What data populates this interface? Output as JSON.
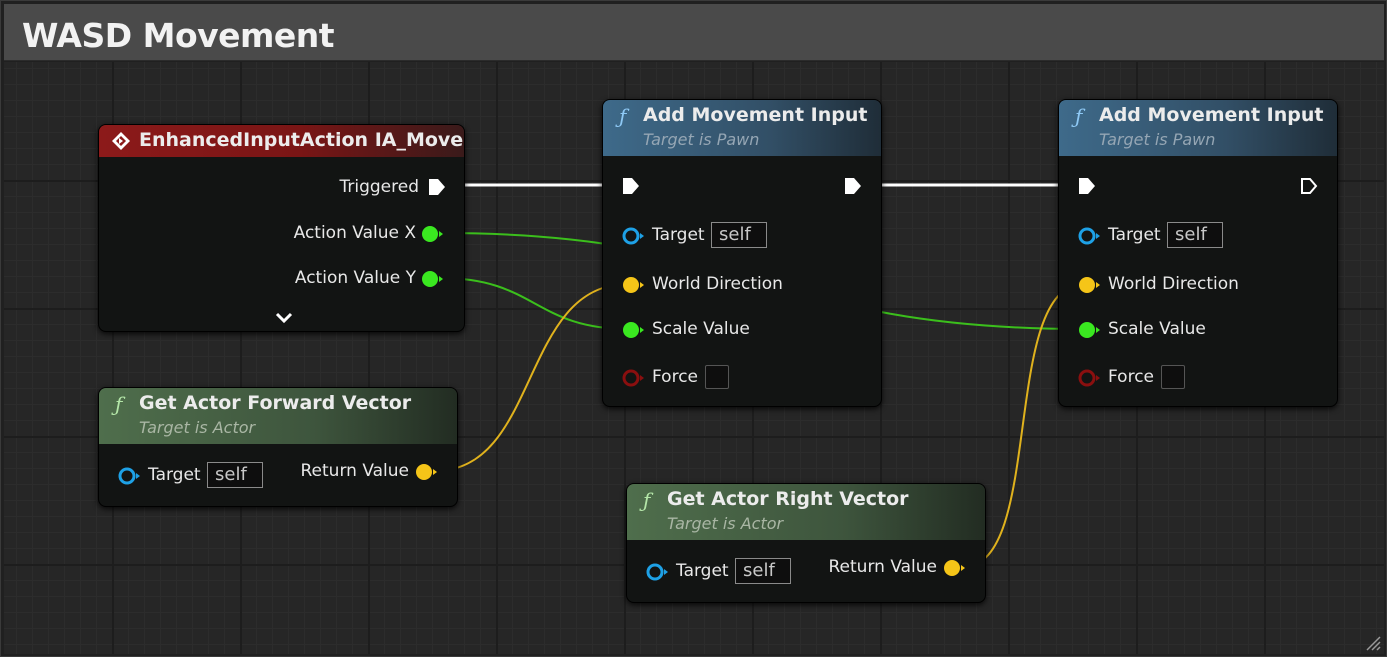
{
  "graph": {
    "comment_title": "WASD Movement"
  },
  "colors": {
    "exec": "#ffffff",
    "float_pin": "#3ae820",
    "vector_pin": "#f5c518",
    "object_pin": "#1ea1e6",
    "bool_pin": "#8a0f0f",
    "float_wire": "#3bbf1c",
    "vector_wire": "#e0b21d"
  },
  "nodes": {
    "event": {
      "title": "EnhancedInputAction IA_Move",
      "icon": "event-diamond-icon",
      "pins": {
        "triggered": "Triggered",
        "action_x": "Action Value X",
        "action_y": "Action Value Y"
      },
      "expand_icon": "chevron-down-icon"
    },
    "forward": {
      "title": "Get Actor Forward Vector",
      "subtitle": "Target is Actor",
      "icon": "function-icon",
      "target_label": "Target",
      "target_value": "self",
      "return_label": "Return Value"
    },
    "right": {
      "title": "Get Actor Right Vector",
      "subtitle": "Target is Actor",
      "icon": "function-icon",
      "target_label": "Target",
      "target_value": "self",
      "return_label": "Return Value"
    },
    "add1": {
      "title": "Add Movement Input",
      "subtitle": "Target is Pawn",
      "icon": "function-icon",
      "target_label": "Target",
      "target_value": "self",
      "world_direction": "World Direction",
      "scale_value": "Scale Value",
      "force": "Force"
    },
    "add2": {
      "title": "Add Movement Input",
      "subtitle": "Target is Pawn",
      "icon": "function-icon",
      "target_label": "Target",
      "target_value": "self",
      "world_direction": "World Direction",
      "scale_value": "Scale Value",
      "force": "Force"
    }
  }
}
